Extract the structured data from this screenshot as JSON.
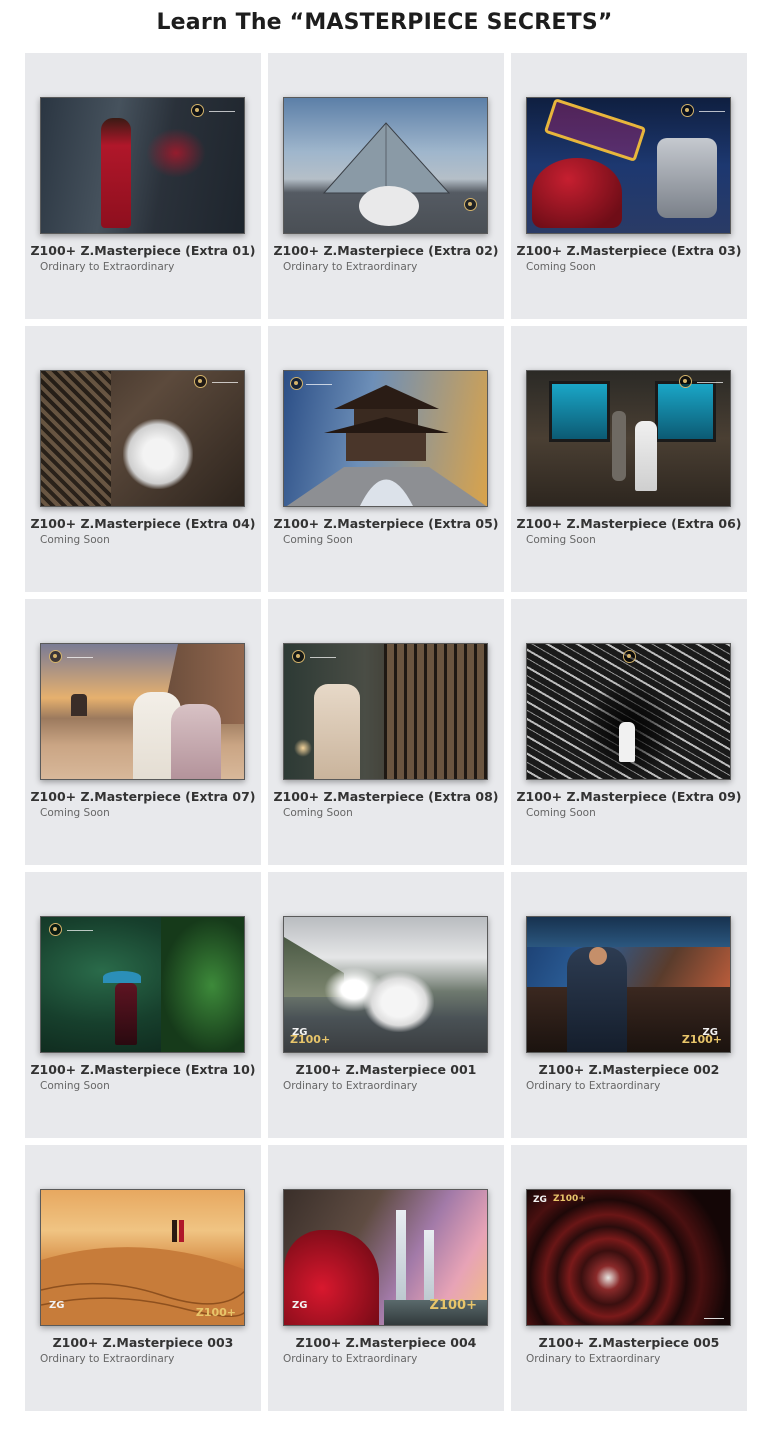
{
  "page_title": "Learn The “MASTERPIECE SECRETS”",
  "cards": [
    {
      "title": "Z100+ Z.Masterpiece (Extra 01)",
      "subtitle": "Ordinary to Extraordinary"
    },
    {
      "title": "Z100+ Z.Masterpiece (Extra 02)",
      "subtitle": "Ordinary to Extraordinary"
    },
    {
      "title": "Z100+ Z.Masterpiece (Extra 03)",
      "subtitle": "Coming Soon"
    },
    {
      "title": "Z100+ Z.Masterpiece (Extra 04)",
      "subtitle": "Coming Soon"
    },
    {
      "title": "Z100+ Z.Masterpiece (Extra 05)",
      "subtitle": "Coming Soon"
    },
    {
      "title": "Z100+ Z.Masterpiece (Extra 06)",
      "subtitle": "Coming Soon"
    },
    {
      "title": "Z100+ Z.Masterpiece (Extra 07)",
      "subtitle": "Coming Soon"
    },
    {
      "title": "Z100+ Z.Masterpiece (Extra 08)",
      "subtitle": "Coming Soon"
    },
    {
      "title": "Z100+ Z.Masterpiece (Extra 09)",
      "subtitle": "Coming Soon"
    },
    {
      "title": "Z100+ Z.Masterpiece (Extra 10)",
      "subtitle": "Coming Soon"
    },
    {
      "title": "Z100+ Z.Masterpiece 001",
      "subtitle": "Ordinary to Extraordinary",
      "badge": "Z100+",
      "logo_text": "ZG"
    },
    {
      "title": "Z100+ Z.Masterpiece 002",
      "subtitle": "Ordinary to Extraordinary",
      "badge": "Z100+",
      "logo_text": "ZG"
    },
    {
      "title": "Z100+ Z.Masterpiece 003",
      "subtitle": "Ordinary to Extraordinary",
      "badge": "Z100+",
      "logo_text": "ZG"
    },
    {
      "title": "Z100+ Z.Masterpiece 004",
      "subtitle": "Ordinary to Extraordinary",
      "badge": "Z100+",
      "logo_text": "ZG"
    },
    {
      "title": "Z100+ Z.Masterpiece 005",
      "subtitle": "Ordinary to Extraordinary",
      "badge": "Z100+",
      "logo_text": "ZG"
    }
  ]
}
